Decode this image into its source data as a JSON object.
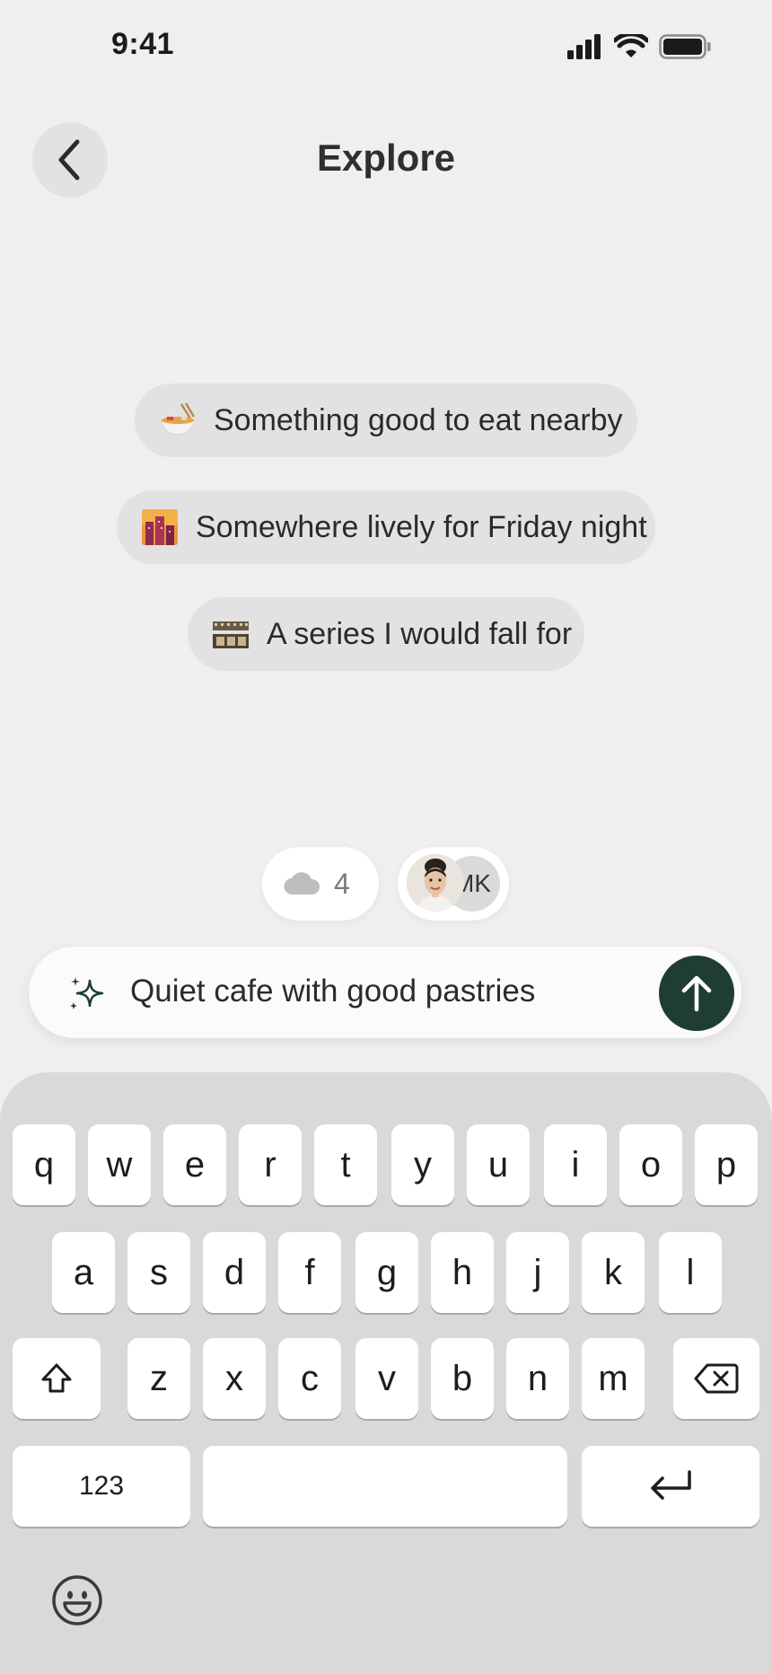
{
  "status_bar": {
    "time": "9:41"
  },
  "header": {
    "title": "Explore"
  },
  "suggestions": [
    {
      "icon": "noodle-bowl-icon",
      "label": "Something good to eat nearby"
    },
    {
      "icon": "city-sunset-icon",
      "label": "Somewhere lively for Friday night"
    },
    {
      "icon": "film-strip-icon",
      "label": "A series I would fall for"
    }
  ],
  "pills": {
    "cloud_count": "4",
    "avatar_initials": "MK"
  },
  "input": {
    "value": "Quiet cafe with good pastries"
  },
  "keyboard": {
    "row1": [
      "q",
      "w",
      "e",
      "r",
      "t",
      "y",
      "u",
      "i",
      "o",
      "p"
    ],
    "row2": [
      "a",
      "s",
      "d",
      "f",
      "g",
      "h",
      "j",
      "k",
      "l"
    ],
    "row3": [
      "z",
      "x",
      "c",
      "v",
      "b",
      "n",
      "m"
    ],
    "numbers_label": "123"
  },
  "colors": {
    "background": "#efefef",
    "send_button": "#1f3d33",
    "chip": "#e2e2e2",
    "keyboard": "#d9d9d9"
  }
}
